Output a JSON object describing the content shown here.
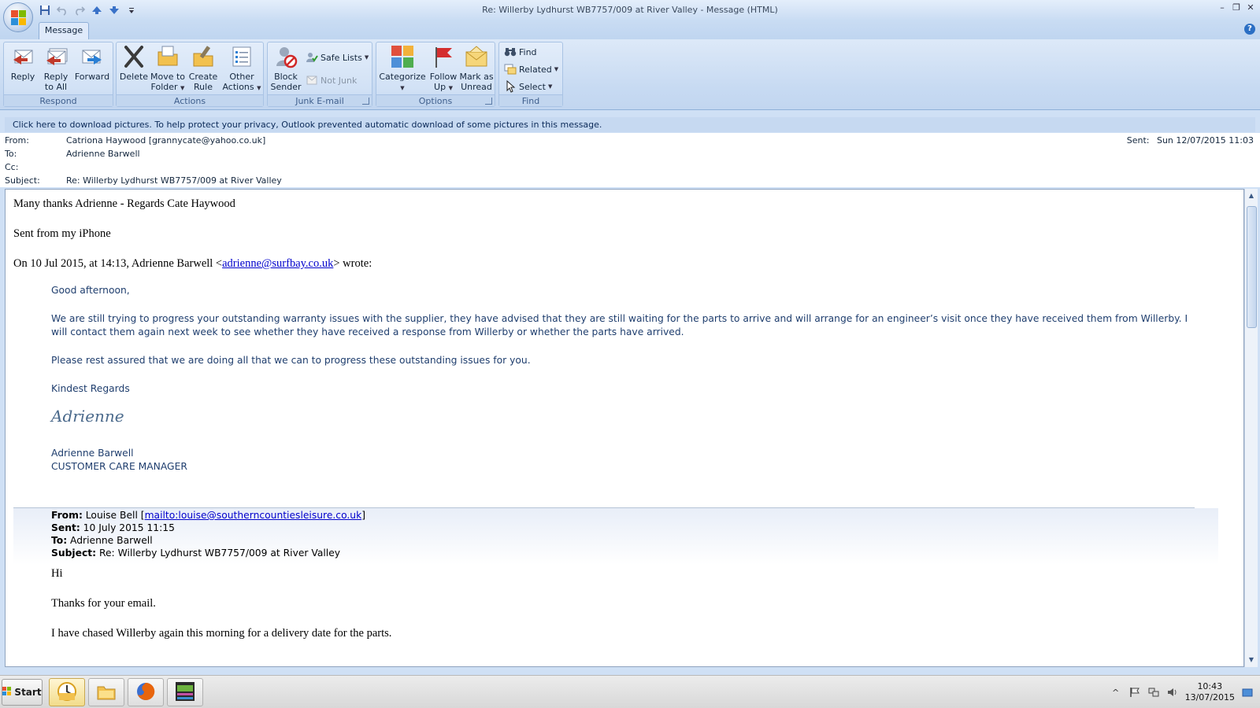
{
  "window": {
    "title": "Re: Willerby Lydhurst WB7757/009 at River Valley - Message (HTML)"
  },
  "quick_access": [
    "save-icon",
    "undo-icon",
    "redo-icon",
    "previous-item-icon",
    "next-item-icon",
    "customize-icon"
  ],
  "ribbon": {
    "tab": "Message",
    "groups": {
      "respond": {
        "label": "Respond",
        "reply": "Reply",
        "reply_all_1": "Reply",
        "reply_all_2": "to All",
        "forward": "Forward"
      },
      "actions": {
        "label": "Actions",
        "delete": "Delete",
        "move_1": "Move to",
        "move_2": "Folder",
        "rule_1": "Create",
        "rule_2": "Rule",
        "other_1": "Other",
        "other_2": "Actions"
      },
      "junk": {
        "label": "Junk E-mail",
        "block_1": "Block",
        "block_2": "Sender",
        "safe_lists": "Safe Lists",
        "not_junk": "Not Junk"
      },
      "options": {
        "label": "Options",
        "categorize": "Categorize",
        "follow_1": "Follow",
        "follow_2": "Up",
        "mark_1": "Mark as",
        "mark_2": "Unread"
      },
      "find": {
        "label": "Find",
        "find": "Find",
        "related": "Related",
        "select": "Select"
      }
    }
  },
  "infobar": "Click here to download pictures. To help protect your privacy, Outlook prevented automatic download of some pictures in this message.",
  "header": {
    "from_label": "From:",
    "from": "Catriona Haywood [grannycate@yahoo.co.uk]",
    "to_label": "To:",
    "to": "Adrienne Barwell",
    "cc_label": "Cc:",
    "cc": "",
    "subject_label": "Subject:",
    "subject": "Re: Willerby Lydhurst WB7757/009 at River Valley",
    "sent_label": "Sent:",
    "sent": "Sun 12/07/2015 11:03"
  },
  "body": {
    "line1": "Many thanks Adrienne - Regards Cate Haywood",
    "line2": "Sent from my iPhone",
    "quote_intro_pre": "On 10 Jul 2015, at 14:13, Adrienne Barwell <",
    "quote_intro_email": "adrienne@surfbay.co.uk",
    "quote_intro_post": "> wrote:",
    "greeting": "Good afternoon,",
    "para1_line1": "We are still trying to progress your outstanding warranty issues with the supplier, they have advised that they are still waiting for the parts to arrive and will arrange for an engineer’s visit once they have received them from Willerby.    I",
    "para1_line2": "will  contact them again next week to see whether they have received a response from Willerby or whether the parts have arrived.",
    "para2": "Please rest assured that we are doing all that we can to progress these outstanding issues for you.",
    "regards": "Kindest Regards",
    "signature": "Adrienne",
    "sig_name": "Adrienne Barwell",
    "sig_title": "CUSTOMER CARE MANAGER",
    "fwd": {
      "from_label": "From:",
      "from_name": "Louise Bell [",
      "from_link": "mailto:louise@southerncountiesleisure.co.uk",
      "from_close": "]",
      "sent_label": "Sent:",
      "sent": "10 July 2015 11:15",
      "to_label": "To:",
      "to": "Adrienne Barwell",
      "subject_label": "Subject:",
      "subject": "Re: Willerby Lydhurst WB7757/009 at River Valley"
    },
    "fwd_hi": "Hi",
    "fwd_thanks": "Thanks for your email.",
    "fwd_chased": "I have chased Willerby again this morning for a delivery date for the parts."
  },
  "taskbar": {
    "start": "Start",
    "apps": [
      "outlook-icon",
      "explorer-icon",
      "firefox-icon",
      "sage-icon"
    ],
    "time": "10:43",
    "date": "13/07/2015"
  },
  "colors": {
    "ribbon_bg": "#c7daf2",
    "link": "#0000cc",
    "quote_text": "#1f3e6e",
    "infobar_bg": "#c6d9f1"
  }
}
